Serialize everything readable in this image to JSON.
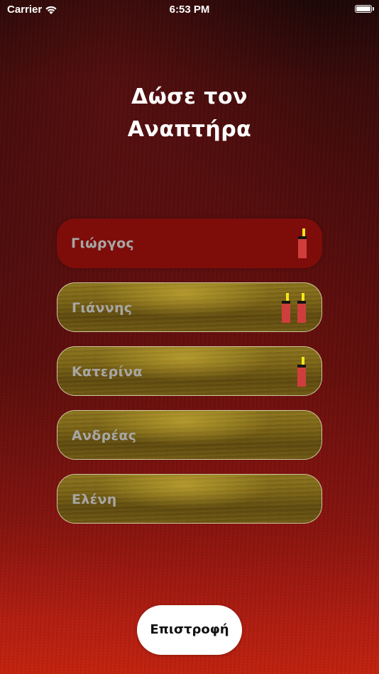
{
  "status_bar": {
    "carrier": "Carrier",
    "time": "6:53 PM",
    "wifi_icon": "wifi-icon",
    "battery_icon": "battery-icon"
  },
  "title": {
    "line1": "Δώσε τον",
    "line2": "Αναπτήρα"
  },
  "players": [
    {
      "name": "Γιώργος",
      "lighters": 1,
      "selected": true
    },
    {
      "name": "Γιάννης",
      "lighters": 2,
      "selected": false
    },
    {
      "name": "Κατερίνα",
      "lighters": 1,
      "selected": false
    },
    {
      "name": "Ανδρέας",
      "lighters": 0,
      "selected": false
    },
    {
      "name": "Ελένη",
      "lighters": 0,
      "selected": false
    }
  ],
  "back_button": {
    "label": "Επιστροφή"
  },
  "colors": {
    "selected_row": "#7e0d0a",
    "player_text": "#a7a6a4",
    "lighter_body": "#cf3e3c",
    "lighter_flame": "#f3e51a",
    "button_bg": "#ffffff"
  }
}
